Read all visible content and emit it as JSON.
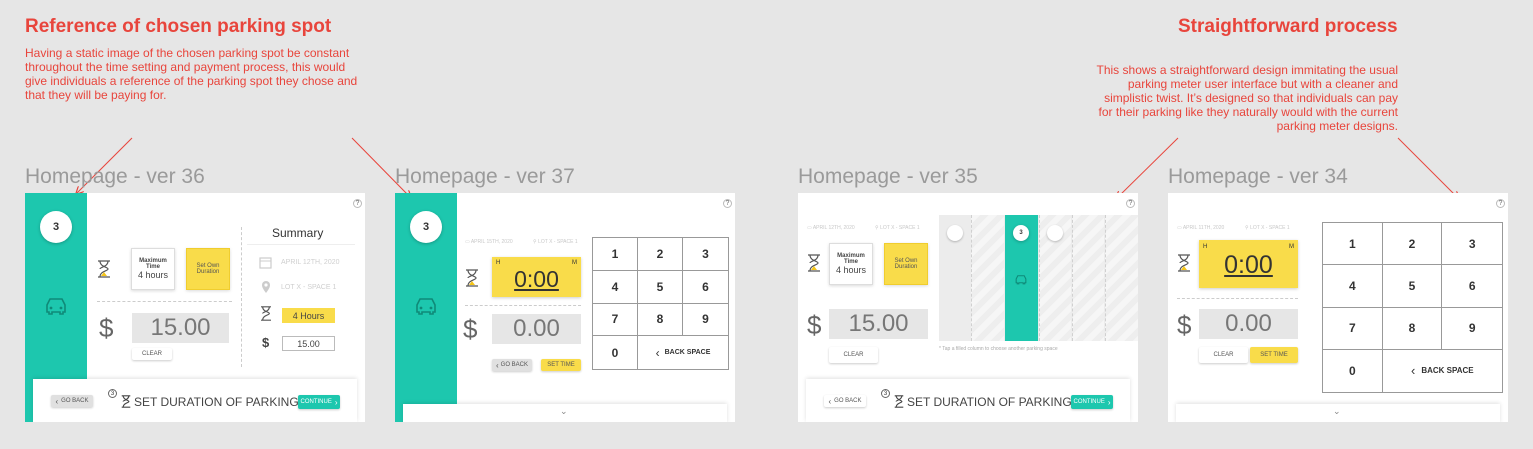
{
  "annotations": {
    "left": {
      "title": "Reference of chosen parking spot",
      "text": "Having a static image of the chosen parking spot be constant throughout the time setting and payment process, this would give individuals a reference of the parking spot they chose and that they will be paying for."
    },
    "right": {
      "title": "Straightforward process",
      "text": "This shows a straightforward design immitating the usual parking meter user interface but with a cleaner and simplistic twist. It’s designed so that individuals can pay for their parking like they naturally would with the current parking meter designs."
    }
  },
  "frames": {
    "v36": {
      "label": "Homepage - ver 36",
      "step": "3",
      "help": "?",
      "max_time": "Maximum Time",
      "max_time_value": "4 hours",
      "set_own": "Set Own Duration",
      "amount": "15.00",
      "currency": "$",
      "clear": "CLEAR",
      "summary_title": "Summary",
      "summary_date": "APRIL 12TH, 2020",
      "summary_lot": "LOT X - SPACE 1",
      "summary_hours": "4 Hours",
      "summary_amount": "15.00",
      "go_back": "GO BACK",
      "footer_step": "3",
      "footer_title": "SET DURATION OF PARKING",
      "continue": "CONTINUE"
    },
    "v37": {
      "label": "Homepage - ver 37",
      "step": "3",
      "help": "?",
      "date": "APRIL 15TH, 2020",
      "lot": "LOT X - SPACE 1",
      "h": "H",
      "m": "M",
      "time": "0:00",
      "currency": "$",
      "amount": "0.00",
      "go_back": "GO BACK",
      "set_time": "SET TIME",
      "keys": [
        "1",
        "2",
        "3",
        "4",
        "5",
        "6",
        "7",
        "8",
        "9",
        "0"
      ],
      "backspace": "BACK SPACE"
    },
    "v35": {
      "label": "Homepage - ver 35",
      "help": "?",
      "date": "APRIL 12TH, 2020",
      "lot": "LOT X - SPACE 1",
      "max_time": "Maximum Time",
      "max_time_value": "4 hours",
      "set_own": "Set Own Duration",
      "currency": "$",
      "amount": "15.00",
      "clear": "CLEAR",
      "step": "3",
      "tap_note": "* Tap a filled column to choose another parking space",
      "go_back": "GO BACK",
      "footer_step": "3",
      "footer_title": "SET DURATION OF PARKING",
      "continue": "CONTINUE"
    },
    "v34": {
      "label": "Homepage - ver 34",
      "help": "?",
      "date": "APRIL 11TH, 2020",
      "lot": "LOT X - SPACE 1",
      "h": "H",
      "m": "M",
      "time": "0:00",
      "currency": "$",
      "amount": "0.00",
      "clear": "CLEAR",
      "set_time": "SET TIME",
      "keys": [
        "1",
        "2",
        "3",
        "4",
        "5",
        "6",
        "7",
        "8",
        "9",
        "0"
      ],
      "backspace": "BACK SPACE"
    }
  },
  "colors": {
    "teal": "#1dc7ae",
    "yellow": "#f9dc4a",
    "annotation": "#e8453c"
  }
}
